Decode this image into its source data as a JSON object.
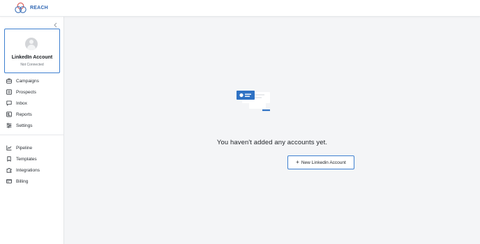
{
  "app": {
    "brand": "REACH",
    "colors": {
      "accent": "#2f72c4",
      "border_active": "#3d7fd0",
      "main_bg": "#f4f5f7",
      "logo_red": "#d9534f"
    }
  },
  "sidebar": {
    "collapse_icon": "chevron-left-icon",
    "account": {
      "title": "LinkedIn Account",
      "status": "Not Connected",
      "icon": "user-avatar-icon"
    },
    "items_primary": [
      {
        "label": "Campaigns",
        "icon": "briefcase-icon"
      },
      {
        "label": "Prospects",
        "icon": "list-icon"
      },
      {
        "label": "Inbox",
        "icon": "chat-icon"
      },
      {
        "label": "Reports",
        "icon": "report-icon"
      },
      {
        "label": "Settings",
        "icon": "sliders-icon"
      }
    ],
    "items_secondary": [
      {
        "label": "Pipeline",
        "icon": "chart-line-icon"
      },
      {
        "label": "Templates",
        "icon": "bookmark-icon"
      },
      {
        "label": "Integrations",
        "icon": "puzzle-icon"
      },
      {
        "label": "Billing",
        "icon": "credit-card-icon"
      }
    ]
  },
  "main": {
    "empty_icon": "account-card-illustration",
    "empty_message": "You haven't added any accounts yet.",
    "new_button": {
      "plus": "+",
      "label": "New Linkedin Account"
    }
  }
}
